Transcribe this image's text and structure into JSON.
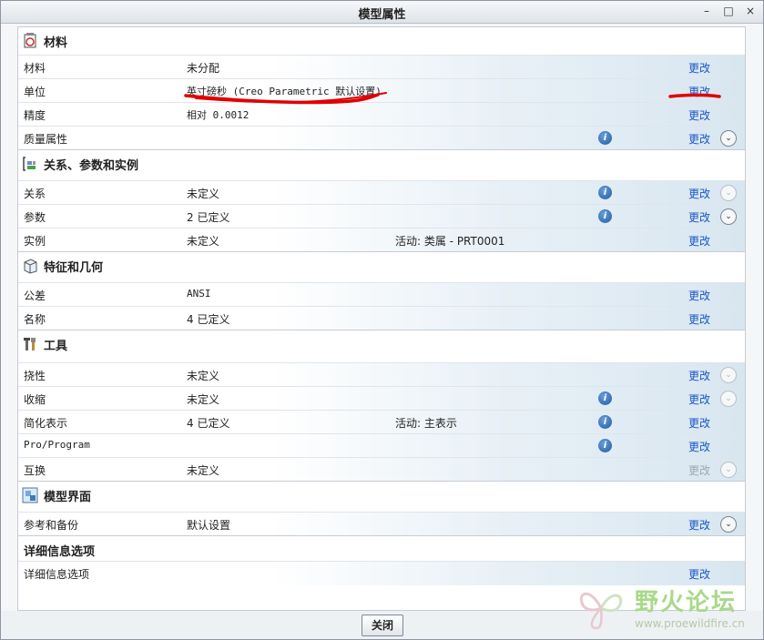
{
  "window": {
    "title": "模型属性",
    "buttons": {
      "minimize": "–",
      "maximize": "□",
      "close": "×"
    }
  },
  "sections": {
    "material": {
      "title": "材料"
    },
    "relations": {
      "title": "关系、参数和实例"
    },
    "features": {
      "title": "特征和几何"
    },
    "tools": {
      "title": "工具"
    },
    "interface": {
      "title": "模型界面"
    },
    "detail": {
      "title": "详细信息选项"
    }
  },
  "rows": {
    "material": {
      "label": "材料",
      "value": "未分配",
      "change": "更改"
    },
    "units": {
      "label": "单位",
      "value": "英寸磅秒 (Creo Parametric 默认设置)",
      "change": "更改"
    },
    "accuracy": {
      "label": "精度",
      "value": "相对 0.0012",
      "change": "更改"
    },
    "mass": {
      "label": "质量属性",
      "change": "更改"
    },
    "relations": {
      "label": "关系",
      "value": "未定义",
      "change": "更改"
    },
    "parameters": {
      "label": "参数",
      "value": "2 已定义",
      "change": "更改"
    },
    "instance": {
      "label": "实例",
      "value": "未定义",
      "extra": "活动: 类属 - PRT0001",
      "change": "更改"
    },
    "tolerance": {
      "label": "公差",
      "value": "ANSI",
      "change": "更改"
    },
    "name": {
      "label": "名称",
      "value": "4 已定义",
      "change": "更改"
    },
    "flexibility": {
      "label": "挠性",
      "value": "未定义",
      "change": "更改"
    },
    "shrink": {
      "label": "收缩",
      "value": "未定义",
      "change": "更改"
    },
    "simplified": {
      "label": "简化表示",
      "value": "4 已定义",
      "extra": "活动: 主表示",
      "change": "更改"
    },
    "proprogram": {
      "label": "Pro/Program",
      "change": "更改"
    },
    "interchange": {
      "label": "互换",
      "value": "未定义",
      "change": "更改"
    },
    "refbackup": {
      "label": "参考和备份",
      "value": "默认设置",
      "change": "更改"
    },
    "detail": {
      "label": "详细信息选项",
      "change": "更改"
    }
  },
  "footer": {
    "close_label": "关闭"
  },
  "watermark": {
    "title": "野火论坛",
    "url": "www.proewildfire.cn"
  },
  "colors": {
    "link": "#1a56c9",
    "annotation": "#e00000"
  }
}
